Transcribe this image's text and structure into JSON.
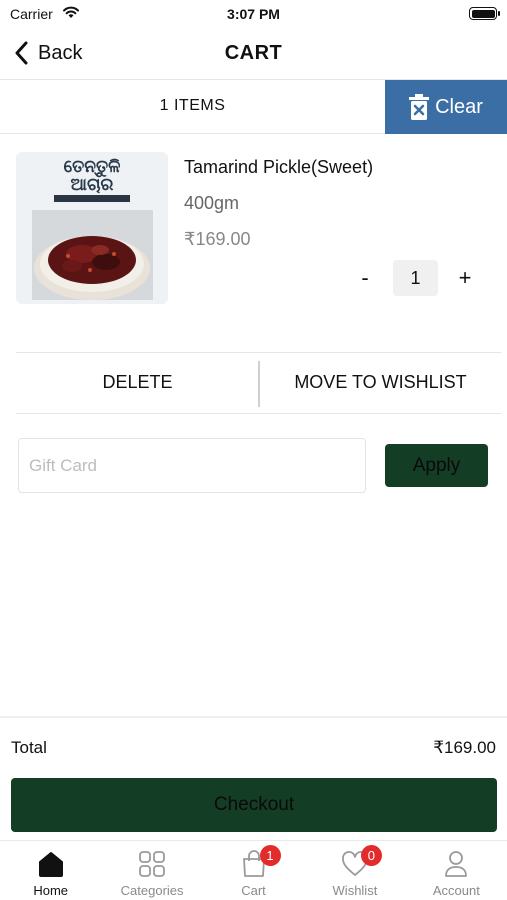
{
  "status_bar": {
    "carrier": "Carrier",
    "time": "3:07 PM"
  },
  "nav": {
    "back_label": "Back",
    "title": "CART"
  },
  "cart_header": {
    "items_count": "1 ITEMS",
    "clear_label": "Clear"
  },
  "product": {
    "name": "Tamarind Pickle(Sweet)",
    "weight": "400gm",
    "price": "₹169.00",
    "image_title_line1": "ତେନ୍ତୁଳି",
    "image_title_line2": "ଆଚାର",
    "quantity": "1",
    "decrement": "-",
    "increment": "+"
  },
  "actions": {
    "delete": "DELETE",
    "move_to_wishlist": "MOVE TO WISHLIST"
  },
  "gift_card": {
    "placeholder": "Gift Card",
    "value": "",
    "apply_label": "Apply"
  },
  "summary": {
    "total_label": "Total",
    "total_value": "₹169.00",
    "checkout_label": "Checkout"
  },
  "tabs": [
    {
      "label": "Home",
      "icon": "home-icon",
      "active": true
    },
    {
      "label": "Categories",
      "icon": "grid-icon",
      "active": false
    },
    {
      "label": "Cart",
      "icon": "shopping-bag-icon",
      "active": false,
      "badge": "1"
    },
    {
      "label": "Wishlist",
      "icon": "heart-icon",
      "active": false,
      "badge": "0"
    },
    {
      "label": "Account",
      "icon": "person-icon",
      "active": false
    }
  ],
  "colors": {
    "clear_button": "#3a6ea5",
    "primary_button": "#143d26",
    "badge": "#e32b2b",
    "inactive_tab": "#8a8a8a"
  }
}
